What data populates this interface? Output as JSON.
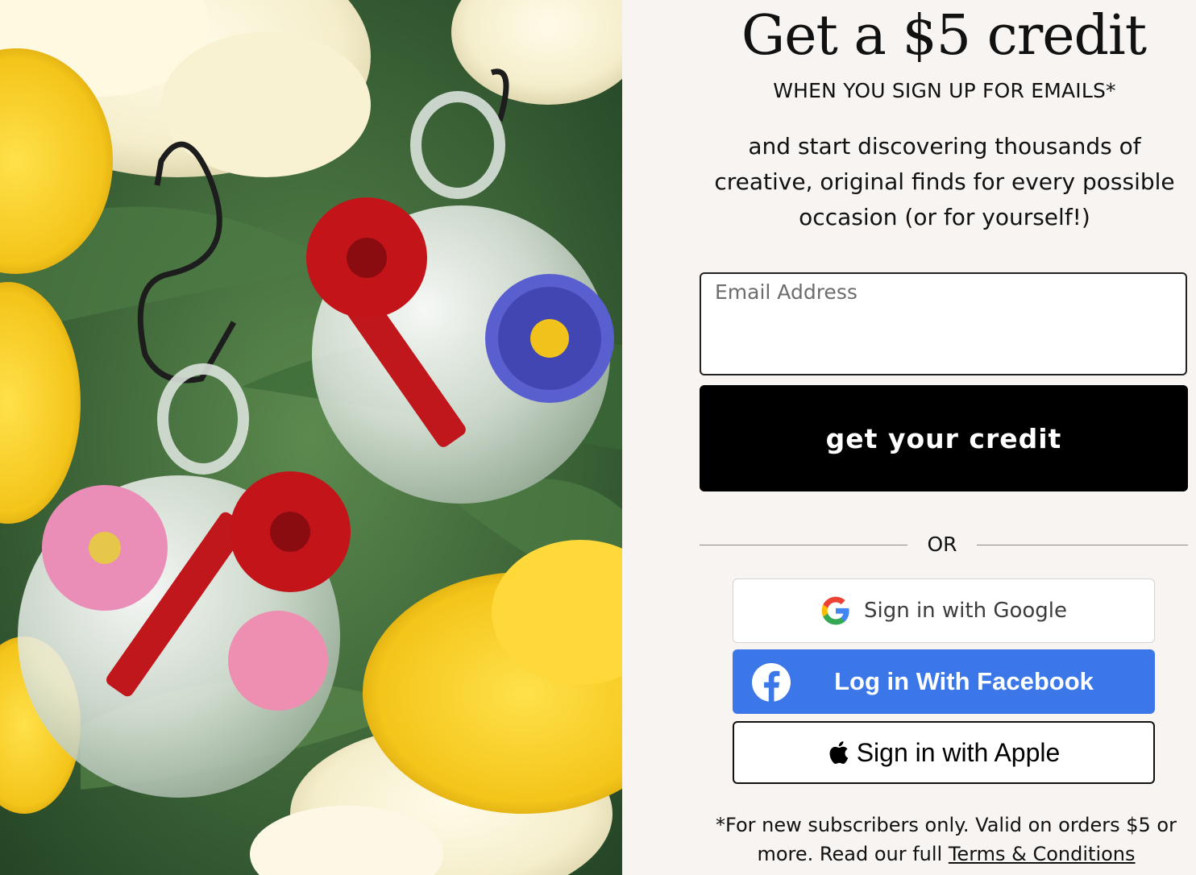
{
  "hero": {
    "image": "hand-blown glass hummingbird feeders with red flower ports, painted blue daisy and pink cosmos, among white and yellow blossoms"
  },
  "signup": {
    "title": "Get a $5 credit",
    "subtitle": "WHEN YOU SIGN UP FOR EMAILS*",
    "blurb": "and start discovering thousands of creative, original finds for every possible occasion (or for yourself!)",
    "email_placeholder": "Email Address",
    "email_value": "",
    "cta_label": "get your credit",
    "divider_label": "OR"
  },
  "social": {
    "google_label": "Sign in with Google",
    "facebook_label": "Log in With Facebook",
    "apple_label": "Sign in with Apple"
  },
  "disclaimer": {
    "text": "*For new subscribers only. Valid on orders $5 or more. Read our full ",
    "link_label": "Terms & Conditions"
  },
  "colors": {
    "background": "#f7f4f1",
    "cta_background": "#000000",
    "facebook_blue": "#3b77e8"
  },
  "icons": [
    "google-g-icon",
    "facebook-f-icon",
    "apple-logo-icon"
  ]
}
